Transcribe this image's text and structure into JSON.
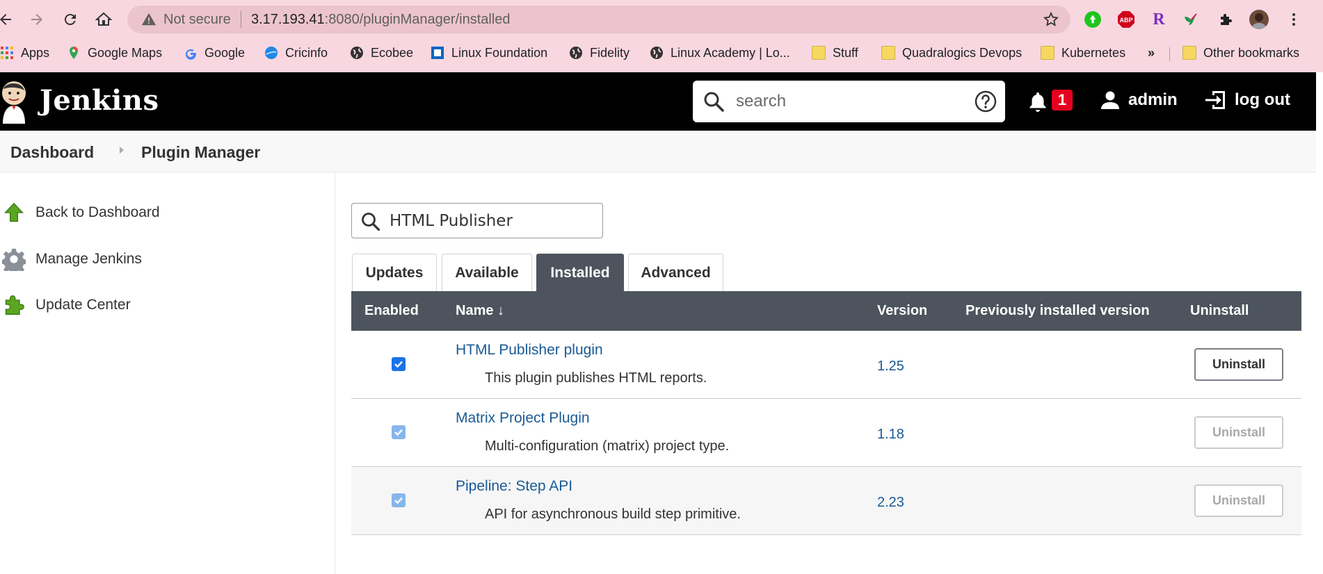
{
  "browser": {
    "security_label": "Not secure",
    "url_host": "3.17.193.41",
    "url_rest": ":8080/pluginManager/installed",
    "extensions": [
      "green-extension-icon",
      "adblock-plus-icon",
      "r-extension-icon",
      "hummingbird-extension-icon",
      "puzzle-extensions-icon",
      "profile-avatar",
      "menu-kebab-icon"
    ],
    "extension_labels": {
      "adblock": "ABP",
      "r": "R"
    },
    "bookmarks": [
      {
        "label": "Apps",
        "icon": "apps-grid-icon"
      },
      {
        "label": "Google Maps",
        "icon": "maps-pin-icon"
      },
      {
        "label": "Google",
        "icon": "google-g-icon"
      },
      {
        "label": "Cricinfo",
        "icon": "cricinfo-icon"
      },
      {
        "label": "Ecobee",
        "icon": "globe-icon"
      },
      {
        "label": "Linux Foundation",
        "icon": "linux-foundation-icon"
      },
      {
        "label": "Fidelity",
        "icon": "globe-icon"
      },
      {
        "label": "Linux Academy | Lo...",
        "icon": "globe-icon"
      },
      {
        "label": "Stuff",
        "icon": "folder-icon"
      },
      {
        "label": "Quadralogics Devops",
        "icon": "folder-icon"
      },
      {
        "label": "Kubernetes",
        "icon": "folder-icon"
      }
    ],
    "overflow_label": "»",
    "other_bookmarks": "Other bookmarks"
  },
  "header": {
    "title": "Jenkins",
    "search_placeholder": "search",
    "notification_count": "1",
    "user": "admin",
    "logout": "log out"
  },
  "breadcrumb": {
    "items": [
      "Dashboard",
      "Plugin Manager"
    ]
  },
  "sidebar": {
    "items": [
      {
        "label": "Back to Dashboard",
        "icon": "up-arrow-icon"
      },
      {
        "label": "Manage Jenkins",
        "icon": "gear-icon"
      },
      {
        "label": "Update Center",
        "icon": "puzzle-icon"
      }
    ]
  },
  "filter": {
    "value": "HTML Publisher"
  },
  "tabs": [
    {
      "label": "Updates",
      "active": false
    },
    {
      "label": "Available",
      "active": false
    },
    {
      "label": "Installed",
      "active": true
    },
    {
      "label": "Advanced",
      "active": false
    }
  ],
  "table": {
    "columns": [
      "Enabled",
      "Name ↓",
      "Version",
      "Previously installed version",
      "Uninstall"
    ],
    "rows": [
      {
        "name": "HTML Publisher plugin",
        "description": "This plugin publishes HTML reports.",
        "version": "1.25",
        "enabled": true,
        "uninstall": "Uninstall",
        "uninstall_enabled": true
      },
      {
        "name": "Matrix Project Plugin",
        "description": "Multi-configuration (matrix) project type.",
        "version": "1.18",
        "enabled": true,
        "uninstall": "Uninstall",
        "uninstall_enabled": false
      },
      {
        "name": "Pipeline: Step API",
        "description": "API for asynchronous build step primitive.",
        "version": "2.23",
        "enabled": true,
        "uninstall": "Uninstall",
        "uninstall_enabled": false
      }
    ]
  },
  "colors": {
    "chrome_bg": "#f9d7e0",
    "header_bg": "#000000",
    "table_header_bg": "#4d545d",
    "link": "#1a5a96",
    "checkbox": "#1a73e8",
    "badge": "#e6001f"
  }
}
